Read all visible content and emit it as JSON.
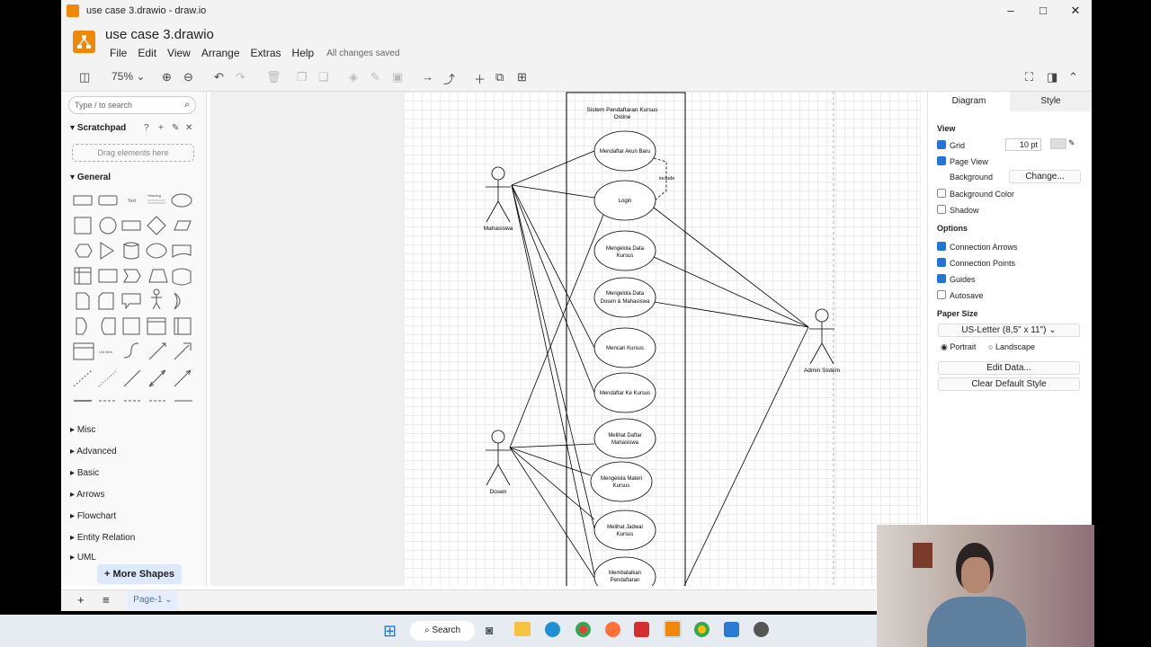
{
  "window": {
    "title": "use case 3.drawio - draw.io",
    "controls": [
      "–",
      "□",
      "✕"
    ]
  },
  "header": {
    "doc_name": "use case 3.drawio",
    "menus": [
      "File",
      "Edit",
      "View",
      "Arrange",
      "Extras",
      "Help"
    ],
    "status": "All changes saved"
  },
  "toolbar": {
    "zoom": "75%"
  },
  "left_panel": {
    "search_placeholder": "Type / to search",
    "scratchpad_label": "Scratchpad",
    "drag_hint": "Drag elements here",
    "general_label": "General",
    "sections": [
      "Misc",
      "Advanced",
      "Basic",
      "Arrows",
      "Flowchart",
      "Entity Relation",
      "UML"
    ],
    "more_shapes": "+ More Shapes"
  },
  "diagram": {
    "system_title_1": "Sistem Pendaftaran Kursus",
    "system_title_2": "Online",
    "actors": {
      "mahasiswa": "Mahasiswa",
      "dosen": "Dosen",
      "admin": "Admin Sistem"
    },
    "include_label": "include",
    "usecases": [
      [
        "Mendaftar Akun Baru"
      ],
      [
        "Login"
      ],
      [
        "Mengelola Data",
        "Kursus"
      ],
      [
        "Mengelola Data",
        "Dosen & Mahasiswa"
      ],
      [
        "Mencari Kursus"
      ],
      [
        "Mendaftar Ke Kursus"
      ],
      [
        "Melihat Daftar",
        "Mahasiswa"
      ],
      [
        "Mengelola Materi",
        "Kursus"
      ],
      [
        "Melihat Jadwal",
        "Kursus"
      ],
      [
        "Membatalkan",
        "Pendaftaran"
      ]
    ]
  },
  "right_panel": {
    "tabs": [
      "Diagram",
      "Style"
    ],
    "view_heading": "View",
    "grid_label": "Grid",
    "grid_size": "10 pt",
    "page_view_label": "Page View",
    "background_label": "Background",
    "change_button": "Change...",
    "bg_color_label": "Background Color",
    "shadow_label": "Shadow",
    "options_heading": "Options",
    "connection_arrows": "Connection Arrows",
    "connection_points": "Connection Points",
    "guides": "Guides",
    "autosave": "Autosave",
    "paper_size_heading": "Paper Size",
    "paper_size": "US-Letter (8,5\" x 11\")",
    "portrait": "Portrait",
    "landscape": "Landscape",
    "edit_data": "Edit Data...",
    "clear_style": "Clear Default Style"
  },
  "bottom": {
    "page_tab": "Page-1"
  },
  "taskbar": {
    "search": "Search"
  }
}
